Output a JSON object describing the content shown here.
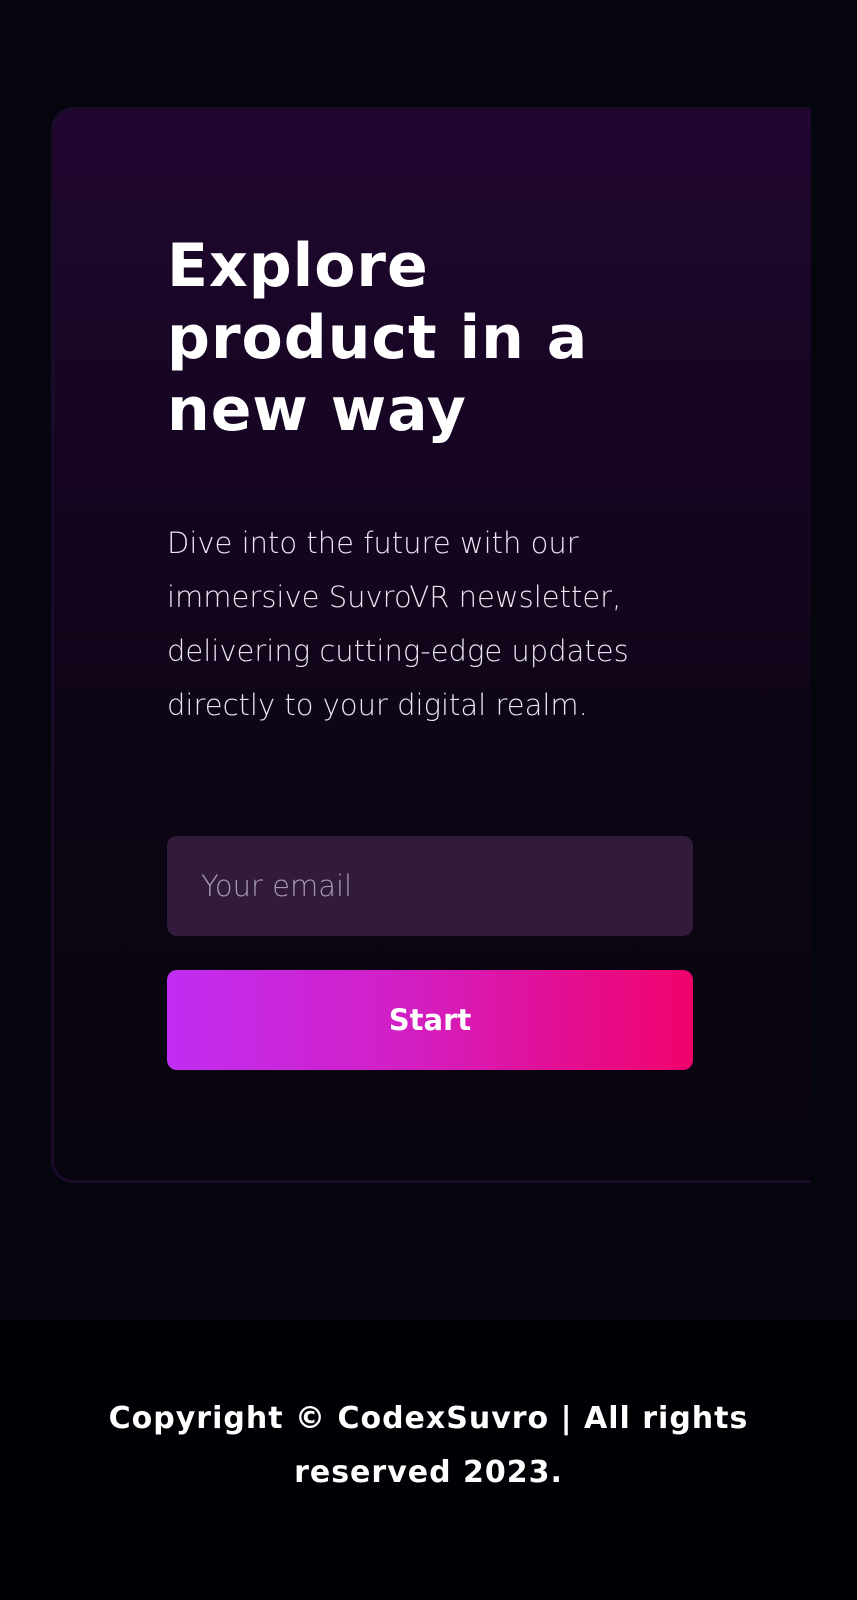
{
  "newsletter": {
    "headline": "Explore product in a new way",
    "description": "Dive into the future with our immersive SuvroVR newsletter, delivering cutting-edge updates directly to your digital realm.",
    "email_placeholder": "Your email",
    "start_label": "Start"
  },
  "footer": {
    "copyright": "Copyright © CodexSuvro | All rights reserved 2023."
  },
  "colors": {
    "background": "#05050e",
    "card_top": "#200630",
    "input_background": "#311a3c",
    "button_gradient_start": "#c12df2",
    "button_gradient_end": "#f0026b"
  }
}
